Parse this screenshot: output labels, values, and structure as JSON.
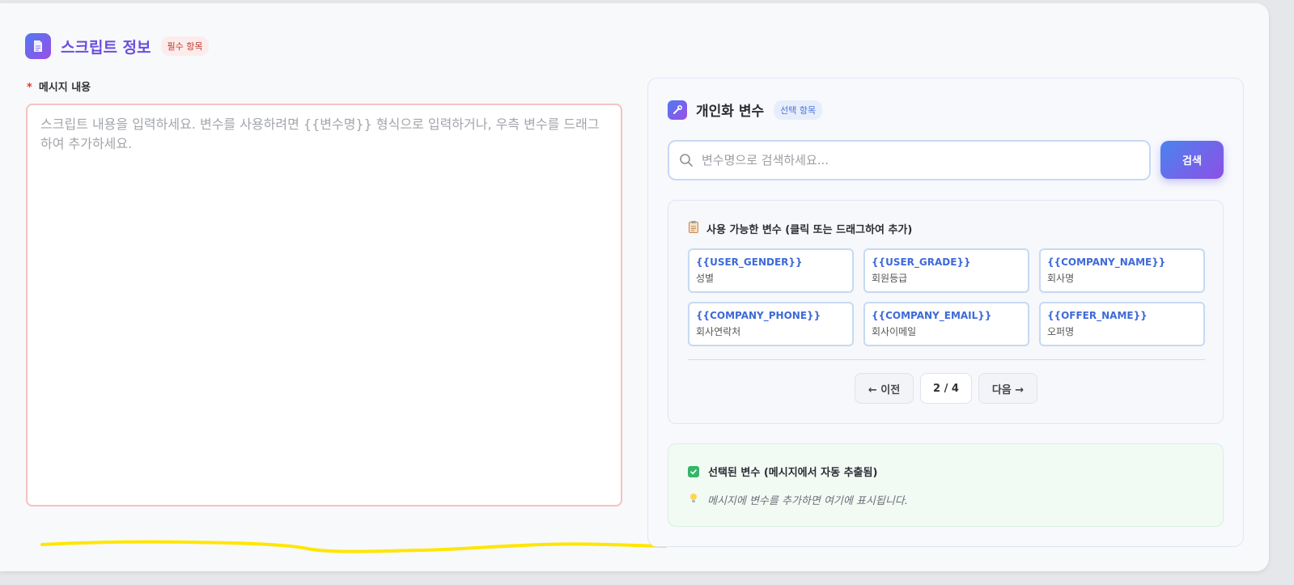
{
  "header": {
    "title": "스크립트 정보",
    "required_badge": "필수 항목",
    "icon": "document-icon"
  },
  "message": {
    "label": "메시지 내용",
    "required_mark": "*",
    "value": "",
    "placeholder": "스크립트 내용을 입력하세요. 변수를 사용하려면 {{변수명}} 형식으로 입력하거나, 우측 변수를 드래그하여 추가하세요."
  },
  "variables_panel": {
    "title": "개인화 변수",
    "optional_badge": "선택 항목",
    "icon": "wrench-icon",
    "search": {
      "placeholder": "변수명으로 검색하세요...",
      "value": "",
      "button_label": "검색"
    },
    "available": {
      "title": "사용 가능한 변수 (클릭 또는 드래그하여 추가)",
      "icon": "clipboard-icon",
      "items": [
        {
          "name": "{{USER_GENDER}}",
          "desc": "성별"
        },
        {
          "name": "{{USER_GRADE}}",
          "desc": "회원등급"
        },
        {
          "name": "{{COMPANY_NAME}}",
          "desc": "회사명"
        },
        {
          "name": "{{COMPANY_PHONE}}",
          "desc": "회사연락처"
        },
        {
          "name": "{{COMPANY_EMAIL}}",
          "desc": "회사이메일"
        },
        {
          "name": "{{OFFER_NAME}}",
          "desc": "오퍼명"
        }
      ],
      "pager": {
        "prev_label": "← 이전",
        "page_info": "2 / 4",
        "next_label": "다음 →"
      }
    },
    "selected": {
      "title": "선택된 변수 (메시지에서 자동 추출됨)",
      "icon": "check-icon",
      "hint": "메시지에 변수를 추가하면 여기에 표시됩니다.",
      "hint_icon": "lightbulb-icon"
    }
  },
  "colors": {
    "accent_gradient_start": "#4f7bf0",
    "accent_gradient_end": "#9b4de8",
    "required": "#e53935",
    "variable_text": "#3d6ad8",
    "annotation_line": "#ffe600"
  }
}
